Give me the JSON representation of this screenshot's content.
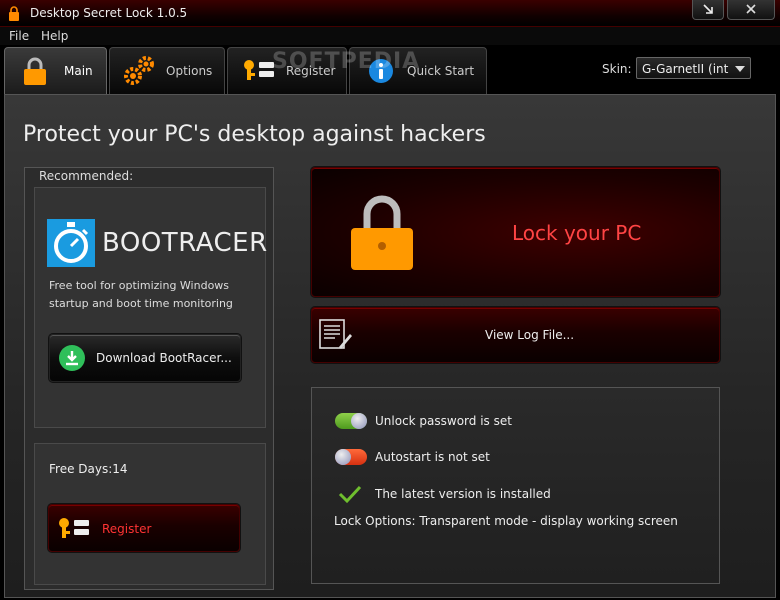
{
  "window": {
    "title": "Desktop Secret Lock 1.0.5"
  },
  "menu": [
    "File",
    "Help"
  ],
  "tabs": [
    {
      "label": "Main",
      "icon": "lock-icon",
      "active": true
    },
    {
      "label": "Options",
      "icon": "gears-icon",
      "active": false
    },
    {
      "label": "Register",
      "icon": "key-icon",
      "active": false
    },
    {
      "label": "Quick Start",
      "icon": "info-icon",
      "active": false
    }
  ],
  "watermark": "SOFTPEDIA",
  "skin": {
    "label": "Skin:",
    "value": "G-GarnetII (int"
  },
  "heading": "Protect your PC's desktop against hackers",
  "recommended": {
    "label": "Recommended:",
    "product_name": "BOOTRACER",
    "description": "Free tool for optimizing Windows startup and boot time monitoring",
    "download_label": "Download BootRacer..."
  },
  "free_days": "Free Days:14",
  "register_label": "Register",
  "lock_label": "Lock your PC",
  "log_label": "View Log File...",
  "status": {
    "unlock_password": "Unlock password is set",
    "autostart": "Autostart is not set",
    "version": "The latest version is installed",
    "lock_options": "Lock Options: Transparent mode - display working screen"
  },
  "colors": {
    "accent_red": "#ff3333",
    "lock_orange": "#ff9900",
    "toggle_on": "#6fbf2e",
    "toggle_off": "#ee4a20",
    "bootracer_blue": "#1a9be0"
  }
}
